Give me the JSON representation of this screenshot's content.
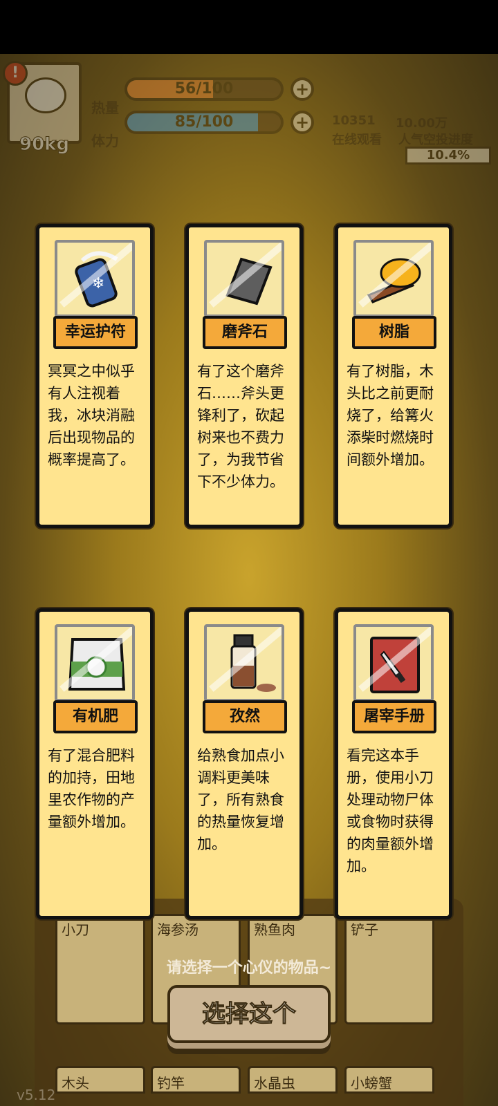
{
  "hud": {
    "weight": "90kg",
    "calories_label": "热量",
    "stamina_label": "体力",
    "calories_value": "56/100",
    "stamina_value": "85/100",
    "calories_level": 0.56,
    "stamina_level": 0.85,
    "calories_color": "#f08a3a",
    "stamina_color": "#4aa0e0",
    "viewers": "10351",
    "viewers_label": "在线观看",
    "popularity": "10.00万",
    "popularity_label": "人气空投进度",
    "airdrop_progress": "10.4%"
  },
  "cards": [
    {
      "name": "幸运护符",
      "icon": "amulet-icon",
      "desc": "冥冥之中似乎有人注视着我，冰块消融后出现物品的概率提高了。"
    },
    {
      "name": "磨斧石",
      "icon": "whetstone-icon",
      "desc": "有了这个磨斧石……斧头更锋利了，砍起树来也不费力了，为我节省下不少体力。"
    },
    {
      "name": "树脂",
      "icon": "resin-icon",
      "desc": "有了树脂，木头比之前更耐烧了，给篝火添柴时燃烧时间额外增加。"
    },
    {
      "name": "有机肥",
      "icon": "fertilizer-bag-icon",
      "desc": "有了混合肥料的加持，田地里农作物的产量额外增加。"
    },
    {
      "name": "孜然",
      "icon": "cumin-jar-icon",
      "desc": "给熟食加点小调料更美味了，所有熟食的热量恢复增加。"
    },
    {
      "name": "屠宰手册",
      "icon": "butcher-book-icon",
      "desc": "看完这本手册，使用小刀处理动物尸体或食物时获得的肉量额外增加。"
    }
  ],
  "inventory": {
    "items_row1": [
      "小刀",
      "海参汤",
      "熟鱼肉",
      "铲子"
    ],
    "items_row2": [
      "木头",
      "钓竿",
      "水晶虫",
      "小螃蟹"
    ]
  },
  "prompt": "请选择一个心仪的物品~",
  "choose_button": "选择这个",
  "version": "v5.12"
}
